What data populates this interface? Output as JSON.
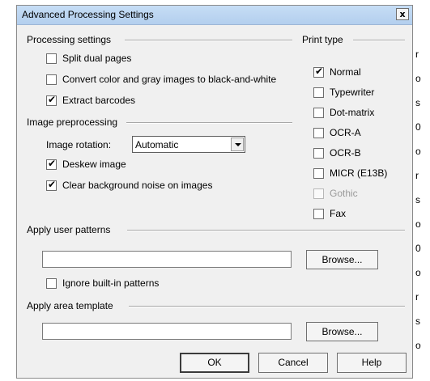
{
  "window": {
    "title": "Advanced Processing Settings",
    "close_glyph": "x"
  },
  "processing": {
    "heading": "Processing settings",
    "split_dual_pages": {
      "label": "Split dual pages",
      "checked": false
    },
    "convert_bw": {
      "label": "Convert color and gray images to black-and-white",
      "checked": false
    },
    "extract_barcodes": {
      "label": "Extract barcodes",
      "checked": true
    }
  },
  "preprocessing": {
    "heading": "Image preprocessing",
    "rotation_label": "Image rotation:",
    "rotation_value": "Automatic",
    "deskew": {
      "label": "Deskew image",
      "checked": true
    },
    "clear_noise": {
      "label": "Clear background noise on images",
      "checked": true
    }
  },
  "print_type": {
    "heading": "Print type",
    "items": [
      {
        "label": "Normal",
        "checked": true,
        "enabled": true
      },
      {
        "label": "Typewriter",
        "checked": false,
        "enabled": true
      },
      {
        "label": "Dot-matrix",
        "checked": false,
        "enabled": true
      },
      {
        "label": "OCR-A",
        "checked": false,
        "enabled": true
      },
      {
        "label": "OCR-B",
        "checked": false,
        "enabled": true
      },
      {
        "label": "MICR (E13B)",
        "checked": false,
        "enabled": true
      },
      {
        "label": "Gothic",
        "checked": false,
        "enabled": false
      },
      {
        "label": "Fax",
        "checked": false,
        "enabled": true
      }
    ]
  },
  "user_patterns": {
    "heading": "Apply user patterns",
    "path_value": "",
    "browse_label": "Browse...",
    "ignore_builtin": {
      "label": "Ignore built-in patterns",
      "checked": false
    }
  },
  "area_template": {
    "heading": "Apply area template",
    "path_value": "",
    "browse_label": "Browse..."
  },
  "footer": {
    "ok_label": "OK",
    "cancel_label": "Cancel",
    "help_label": "Help"
  },
  "check_glyph": "✔",
  "edge_glyphs": [
    "r",
    "o",
    "s",
    "0",
    "o",
    "r",
    "s",
    "o",
    "0",
    "o",
    "r",
    "s",
    "o"
  ]
}
